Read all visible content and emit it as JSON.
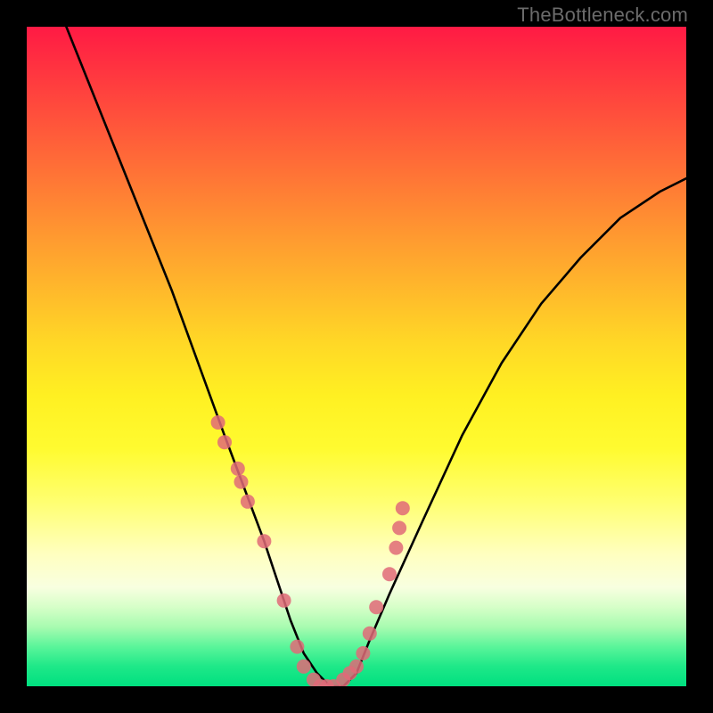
{
  "watermark": {
    "text": "TheBottleneck.com"
  },
  "chart_data": {
    "type": "line",
    "title": "",
    "xlabel": "",
    "ylabel": "",
    "xlim": [
      0,
      100
    ],
    "ylim": [
      0,
      100
    ],
    "grid": false,
    "legend": false,
    "background_gradient": {
      "top": "#ff1a44",
      "middle": "#fff022",
      "bottom": "#00e080"
    },
    "series": [
      {
        "name": "bottleneck-curve",
        "color": "#000000",
        "x": [
          6,
          10,
          14,
          18,
          22,
          26,
          30,
          33,
          36,
          38,
          40,
          42,
          44,
          46,
          48,
          50,
          52,
          55,
          60,
          66,
          72,
          78,
          84,
          90,
          96,
          100
        ],
        "values": [
          100,
          90,
          80,
          70,
          60,
          49,
          38,
          30,
          22,
          16,
          10,
          5,
          2,
          0,
          0,
          2,
          7,
          14,
          25,
          38,
          49,
          58,
          65,
          71,
          75,
          77
        ]
      }
    ],
    "scatter": [
      {
        "name": "markers",
        "color": "#e06a78",
        "x": [
          29,
          30,
          32,
          32.5,
          33.5,
          36,
          39,
          41,
          42,
          43.5,
          44.5,
          45.5,
          46.5,
          48,
          49,
          50,
          51,
          52,
          53,
          55,
          56,
          56.5,
          57
        ],
        "values": [
          40,
          37,
          33,
          31,
          28,
          22,
          13,
          6,
          3,
          1,
          0,
          0,
          0,
          1,
          2,
          3,
          5,
          8,
          12,
          17,
          21,
          24,
          27
        ]
      }
    ]
  }
}
